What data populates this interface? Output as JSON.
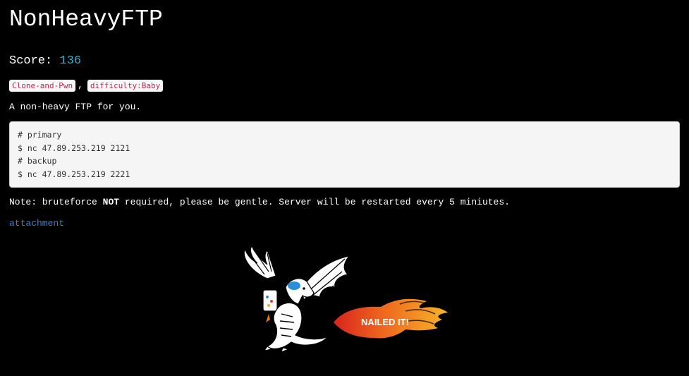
{
  "challenge": {
    "title": "NonHeavyFTP",
    "score_label": "Score:",
    "score_value": "136",
    "tags": [
      "Clone-and-Pwn",
      "difficulty:Baby"
    ],
    "tag_separator": ",",
    "description": "A non-heavy FTP for you.",
    "code_lines": [
      "# primary",
      "$ nc 47.89.253.219 2121",
      "# backup",
      "$ nc 47.89.253.219 2221"
    ],
    "note_prefix": "Note: bruteforce",
    "note_emphasis": "NOT",
    "note_suffix": "required, please be gentle. Server will be restarted every 5 miniutes.",
    "attachment_label": "attachment"
  },
  "illustration": {
    "caption": "NAILED IT!",
    "icon": "dragon-nailed-it-icon"
  },
  "colors": {
    "background": "#000000",
    "text": "#ffffff",
    "score_accent": "#32b0d8",
    "link": "#3a7fcf",
    "tag_text": "#c7254e",
    "tag_bg": "#f8f8f8",
    "code_bg": "#f5f5f5",
    "code_text": "#333333"
  }
}
